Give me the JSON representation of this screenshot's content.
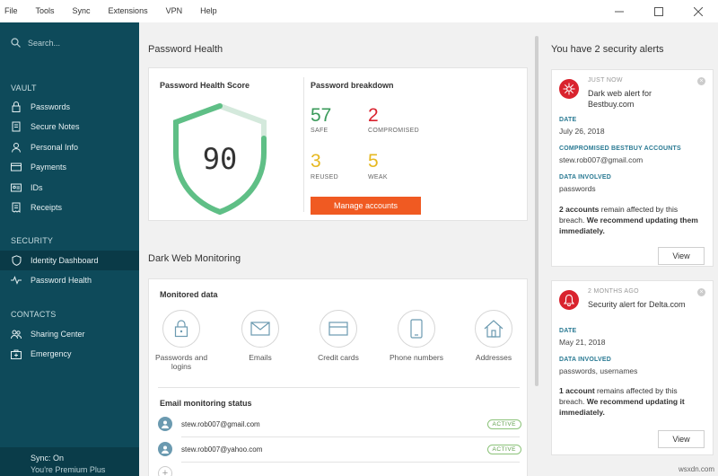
{
  "menubar": {
    "items": [
      "File",
      "Tools",
      "Sync",
      "Extensions",
      "VPN",
      "Help"
    ]
  },
  "sidebar": {
    "search_placeholder": "Search...",
    "vault_head": "VAULT",
    "vault_items": [
      "Passwords",
      "Secure Notes",
      "Personal Info",
      "Payments",
      "IDs",
      "Receipts"
    ],
    "security_head": "SECURITY",
    "security_items": [
      "Identity Dashboard",
      "Password Health"
    ],
    "contacts_head": "CONTACTS",
    "contacts_items": [
      "Sharing Center",
      "Emergency"
    ],
    "footer": {
      "sync": "Sync: On",
      "plan": "You're Premium Plus"
    }
  },
  "password_health": {
    "title": "Password Health",
    "score_label": "Password Health Score",
    "score": "90",
    "breakdown_label": "Password breakdown",
    "safe": {
      "value": "57",
      "label": "SAFE",
      "color": "#3a9a5a"
    },
    "compromised": {
      "value": "2",
      "label": "COMPROMISED",
      "color": "#d9232e"
    },
    "reused": {
      "value": "3",
      "label": "REUSED",
      "color": "#e6b820"
    },
    "weak": {
      "value": "5",
      "label": "WEAK",
      "color": "#e6b820"
    },
    "manage_button": "Manage accounts"
  },
  "dark_web": {
    "title": "Dark Web Monitoring",
    "monitored_label": "Monitored data",
    "items": [
      {
        "label": "Passwords and logins",
        "icon": "lock-icon"
      },
      {
        "label": "Emails",
        "icon": "envelope-icon"
      },
      {
        "label": "Credit cards",
        "icon": "credit-card-icon"
      },
      {
        "label": "Phone numbers",
        "icon": "phone-icon"
      },
      {
        "label": "Addresses",
        "icon": "house-icon"
      }
    ],
    "email_status_label": "Email monitoring status",
    "emails": [
      {
        "address": "stew.rob007@gmail.com",
        "status": "ACTIVE"
      },
      {
        "address": "stew.rob007@yahoo.com",
        "status": "ACTIVE"
      }
    ]
  },
  "alerts": {
    "heading": "You have 2 security alerts",
    "items": [
      {
        "when": "JUST NOW",
        "title": "Dark web alert for Bestbuy.com",
        "date_label": "DATE",
        "date": "July 26, 2018",
        "accounts_label": "COMPROMISED BESTBUY ACCOUNTS",
        "accounts": "stew.rob007@gmail.com",
        "data_label": "DATA INVOLVED",
        "data": "passwords",
        "message_bold": "2 accounts",
        "message_mid": " remain affected by this breach. ",
        "message_bold2": "We recommend updating them immediately.",
        "button": "View"
      },
      {
        "when": "2 MONTHS AGO",
        "title": "Security alert for Delta.com",
        "date_label": "DATE",
        "date": "May 21, 2018",
        "data_label": "DATA INVOLVED",
        "data": "passwords, usernames",
        "message_bold": "1 account",
        "message_mid": " remains affected by this breach. ",
        "message_bold2": "We recommend updating it immediately.",
        "button": "View"
      }
    ]
  },
  "watermark": "wsxdn.com"
}
